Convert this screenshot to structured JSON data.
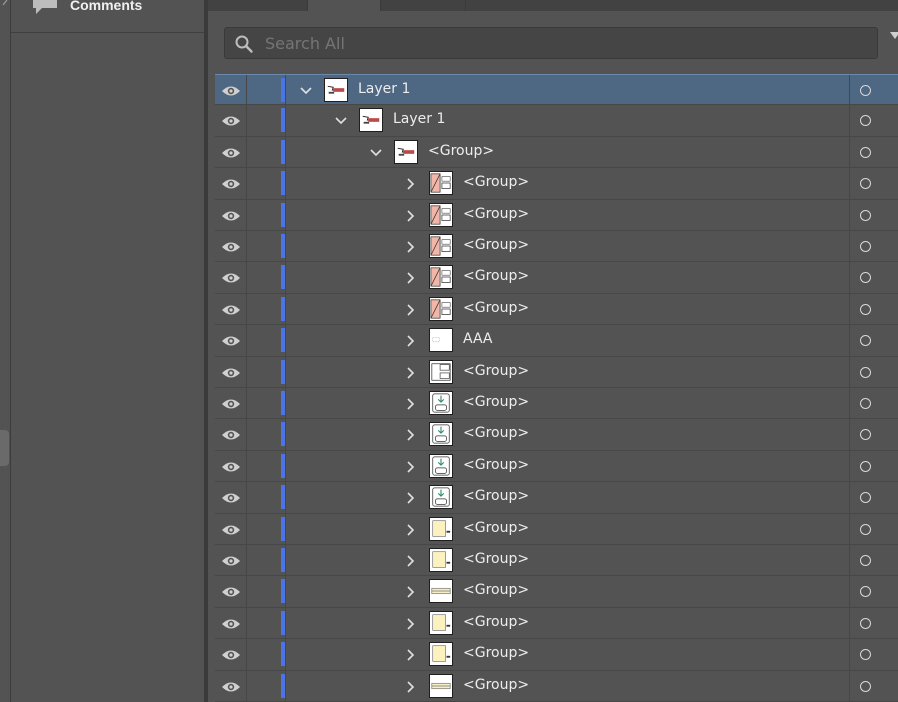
{
  "sidebar": {
    "items": [
      {
        "label": "Comments",
        "icon": "comment-icon"
      }
    ]
  },
  "layers_panel": {
    "search": {
      "placeholder": "Search All",
      "value": ""
    },
    "colors": {
      "selected_row": "#4e6782",
      "layer_color": "#4b74e6",
      "panel_bg": "#535353"
    },
    "rows": [
      {
        "name": "Layer 1",
        "depth": 0,
        "expanded": true,
        "selected": true,
        "thumb": "layer"
      },
      {
        "name": "Layer 1",
        "depth": 1,
        "expanded": true,
        "selected": false,
        "thumb": "layer"
      },
      {
        "name": "<Group>",
        "depth": 2,
        "expanded": true,
        "selected": false,
        "thumb": "layer"
      },
      {
        "name": "<Group>",
        "depth": 3,
        "expanded": false,
        "selected": false,
        "thumb": "breaker"
      },
      {
        "name": "<Group>",
        "depth": 3,
        "expanded": false,
        "selected": false,
        "thumb": "breaker"
      },
      {
        "name": "<Group>",
        "depth": 3,
        "expanded": false,
        "selected": false,
        "thumb": "breaker"
      },
      {
        "name": "<Group>",
        "depth": 3,
        "expanded": false,
        "selected": false,
        "thumb": "breaker"
      },
      {
        "name": "<Group>",
        "depth": 3,
        "expanded": false,
        "selected": false,
        "thumb": "breaker"
      },
      {
        "name": "AAA",
        "depth": 3,
        "expanded": false,
        "selected": false,
        "thumb": "blank"
      },
      {
        "name": "<Group>",
        "depth": 3,
        "expanded": false,
        "selected": false,
        "thumb": "box"
      },
      {
        "name": "<Group>",
        "depth": 3,
        "expanded": false,
        "selected": false,
        "thumb": "device"
      },
      {
        "name": "<Group>",
        "depth": 3,
        "expanded": false,
        "selected": false,
        "thumb": "device"
      },
      {
        "name": "<Group>",
        "depth": 3,
        "expanded": false,
        "selected": false,
        "thumb": "device"
      },
      {
        "name": "<Group>",
        "depth": 3,
        "expanded": false,
        "selected": false,
        "thumb": "device"
      },
      {
        "name": "<Group>",
        "depth": 3,
        "expanded": false,
        "selected": false,
        "thumb": "yellow"
      },
      {
        "name": "<Group>",
        "depth": 3,
        "expanded": false,
        "selected": false,
        "thumb": "yellow"
      },
      {
        "name": "<Group>",
        "depth": 3,
        "expanded": false,
        "selected": false,
        "thumb": "line"
      },
      {
        "name": "<Group>",
        "depth": 3,
        "expanded": false,
        "selected": false,
        "thumb": "yellow"
      },
      {
        "name": "<Group>",
        "depth": 3,
        "expanded": false,
        "selected": false,
        "thumb": "yellow"
      },
      {
        "name": "<Group>",
        "depth": 3,
        "expanded": false,
        "selected": false,
        "thumb": "line"
      }
    ]
  }
}
